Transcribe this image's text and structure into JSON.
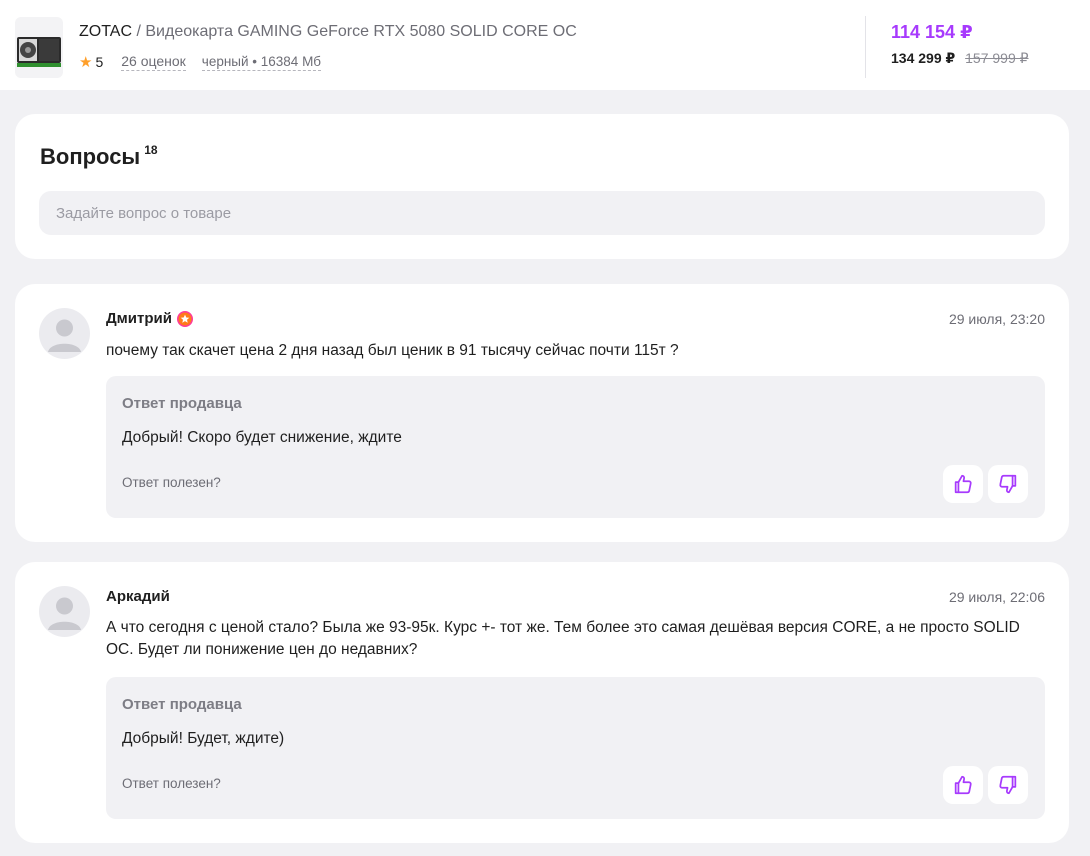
{
  "header": {
    "brand": "ZOTAC",
    "separator": " / ",
    "product_name": "Видеокарта GAMING GeForce RTX 5080 SOLID CORE OC",
    "rating": "5",
    "reviews": "26 оценок",
    "variant": "черный • 16384 Мб",
    "price_main": "114 154 ₽",
    "price_card": "134 299 ₽",
    "price_old": "157 999 ₽",
    "colors": {
      "accent": "#a73afd",
      "star": "#ff9f2a"
    }
  },
  "questions": {
    "title": "Вопросы",
    "count": "18",
    "input_placeholder": "Задайте вопрос о товаре"
  },
  "items": [
    {
      "author": "Дмитрий",
      "has_badge": true,
      "date": "29 июля, 23:20",
      "question": "почему так скачет цена 2 дня назад был ценик в 91 тысячу сейчас почти 115т ?",
      "answer_label": "Ответ продавца",
      "answer": "Добрый! Скоро будет снижение, ждите",
      "helpful_label": "Ответ полезен?"
    },
    {
      "author": "Аркадий",
      "has_badge": false,
      "date": "29 июля, 22:06",
      "question": "А что сегодня с ценой стало? Была же 93-95к. Курс +- тот же. Тем более это самая дешёвая версия CORE, а не просто SOLID OC. Будет ли понижение цен до недавних?",
      "answer_label": "Ответ продавца",
      "answer": "Добрый! Будет, ждите)",
      "helpful_label": "Ответ полезен?"
    }
  ]
}
